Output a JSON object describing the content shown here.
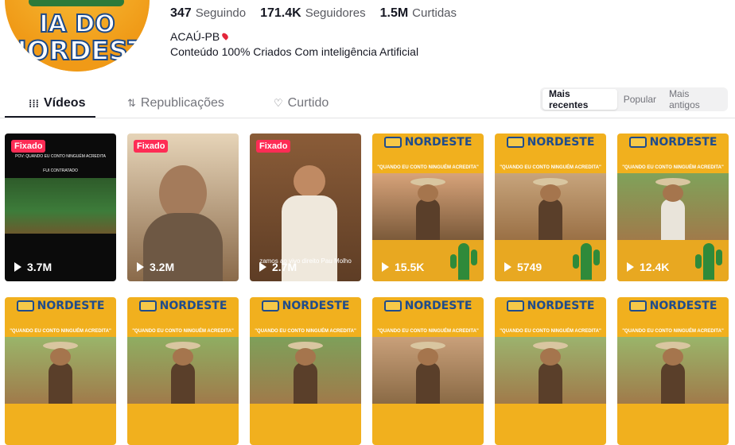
{
  "avatar": {
    "line1": "IA DO",
    "line2": "NORDESTE"
  },
  "stats": [
    {
      "value": "347",
      "label": "Seguindo"
    },
    {
      "value": "171.4K",
      "label": "Seguidores"
    },
    {
      "value": "1.5M",
      "label": "Curtidas"
    }
  ],
  "profile": {
    "location": "ACAÚ-PB",
    "bio": "Conteúdo 100% Criados Com inteligência Artificial"
  },
  "tabs": [
    {
      "icon": "grid-icon",
      "glyph": "⁞⁞⁞",
      "label": "Vídeos"
    },
    {
      "icon": "repost-icon",
      "glyph": "⇅",
      "label": "Republicações"
    },
    {
      "icon": "heart-icon",
      "glyph": "♡",
      "label": "Curtido"
    }
  ],
  "sort": [
    "Mais recentes",
    "Popular",
    "Mais antigos"
  ],
  "videos": [
    {
      "pinned": "Fixado",
      "views": "3.7M",
      "caption": "POV: QUANDO EU CONTO NINGUÉM ACREDITA",
      "sub": "FUI CONTRATADO"
    },
    {
      "pinned": "Fixado",
      "views": "3.2M"
    },
    {
      "pinned": "Fixado",
      "views": "2.7M",
      "overlay": "zamos ao vivo direito Pau Molho"
    },
    {
      "views": "15.5K",
      "brand": "NORDESTE",
      "subtitle": "\"QUANDO EU CONTO NINGUÉM ACREDITA\""
    },
    {
      "views": "5749",
      "brand": "NORDESTE",
      "subtitle": "\"QUANDO EU CONTO NINGUÉM ACREDITA\""
    },
    {
      "views": "12.4K",
      "brand": "NORDESTE",
      "subtitle": "\"QUANDO EU CONTO NINGUÉM ACREDITA\""
    },
    {
      "brand": "NORDESTE",
      "subtitle": "\"QUANDO EU CONTO NINGUÉM ACREDITA\""
    },
    {
      "brand": "NORDESTE",
      "subtitle": "\"QUANDO EU CONTO NINGUÉM ACREDITA\""
    },
    {
      "brand": "NORDESTE",
      "subtitle": "\"QUANDO EU CONTO NINGUÉM ACREDITA\""
    },
    {
      "brand": "NORDESTE",
      "subtitle": "\"QUANDO EU CONTO NINGUÉM ACREDITA\""
    },
    {
      "brand": "NORDESTE",
      "subtitle": "\"QUANDO EU CONTO NINGUÉM ACREDITA\""
    },
    {
      "brand": "NORDESTE",
      "subtitle": "\"QUANDO EU CONTO NINGUÉM ACREDITA\""
    }
  ]
}
